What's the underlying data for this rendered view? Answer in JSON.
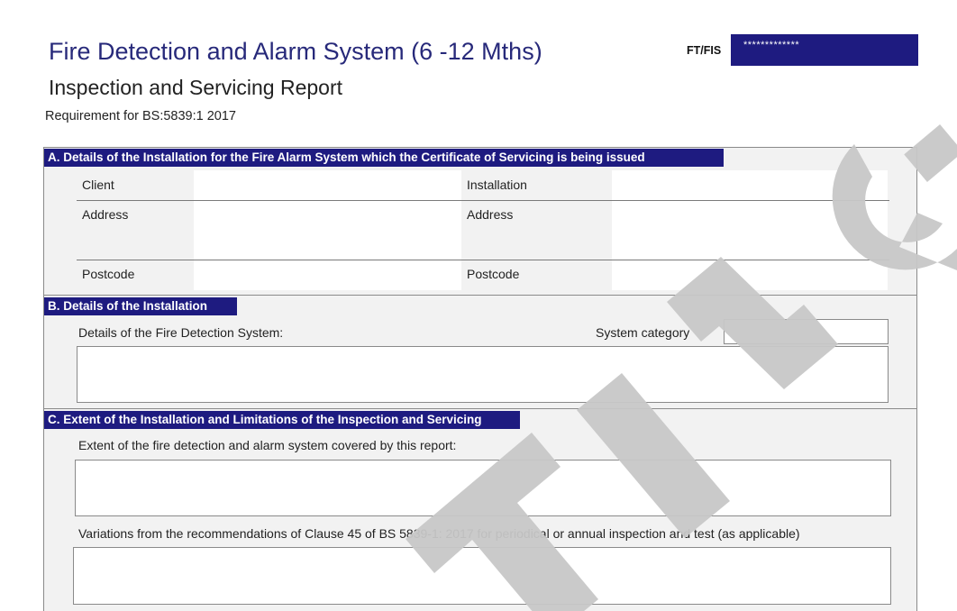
{
  "header": {
    "title": "Fire Detection and Alarm System (6 -12 Mths)",
    "subtitle": "Inspection and Servicing Report",
    "requirement": "Requirement for BS:5839:1 2017",
    "ref_label": "FT/FIS",
    "ref_value": "*************"
  },
  "section_a": {
    "heading": "A. Details of the Installation for the Fire Alarm System which the Certificate of Servicing is being issued",
    "client_label": "Client",
    "installation_label": "Installation",
    "address_label_left": "Address",
    "address_label_right": "Address",
    "postcode_label_left": "Postcode",
    "postcode_label_right": "Postcode"
  },
  "section_b": {
    "heading": "B. Details of the Installation",
    "details_label": "Details of the Fire Detection System:",
    "category_label": "System category"
  },
  "section_c": {
    "heading": "C. Extent of the Installation and Limitations of the Inspection and Servicing",
    "extent_label": "Extent of the fire detection and alarm system covered by this report:",
    "variations_label": "Variations from the recommendations of Clause 45 of BS 5839-1: 2017 for periodical or annual inspection and test (as applicable)"
  },
  "watermark": {
    "letters_visible": "TING",
    "color": "#c8c8c8"
  },
  "colors": {
    "brand_navy": "#1e1b80",
    "title_blue": "#27297a"
  }
}
